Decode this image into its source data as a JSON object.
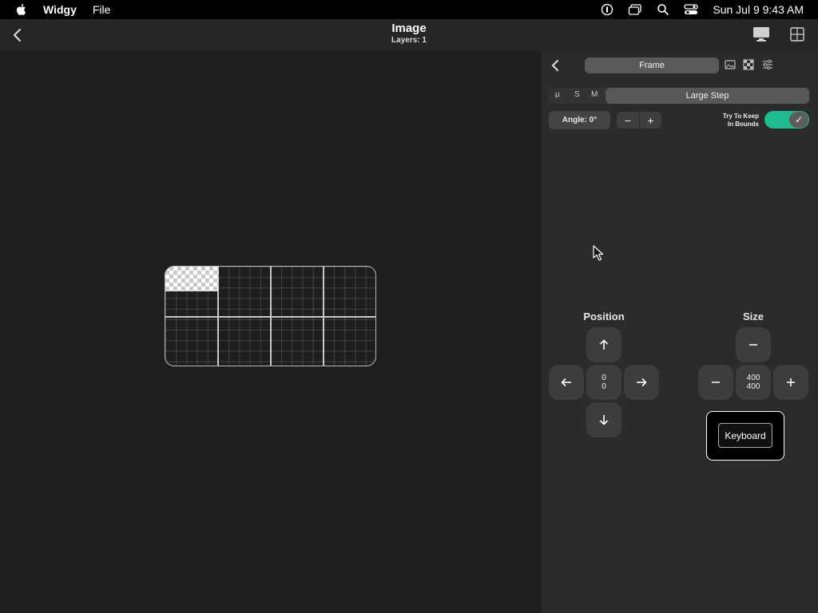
{
  "menubar": {
    "app_name": "Widgy",
    "menu_items": [
      "File"
    ],
    "clock": "Sun Jul 9  9:43 AM"
  },
  "header": {
    "title": "Image",
    "subtitle": "Layers: 1"
  },
  "panel": {
    "frame_tab": "Frame",
    "step_options": [
      "µ",
      "S",
      "M"
    ],
    "large_step": "Large Step",
    "angle_label": "Angle: 0°",
    "minus": "−",
    "plus": "+",
    "bounds_label_line1": "Try To Keep",
    "bounds_label_line2": "In Bounds",
    "bounds_enabled": true,
    "toggle_check": "✓",
    "position": {
      "label": "Position",
      "x": "0",
      "y": "0"
    },
    "size": {
      "label": "Size",
      "width": "400",
      "height": "400"
    },
    "keyboard_label": "Keyboard"
  },
  "colors": {
    "accent_toggle": "#1dbb8f",
    "canvas_bg": "#1e1e1e",
    "panel_bg": "#2b2b2b"
  }
}
